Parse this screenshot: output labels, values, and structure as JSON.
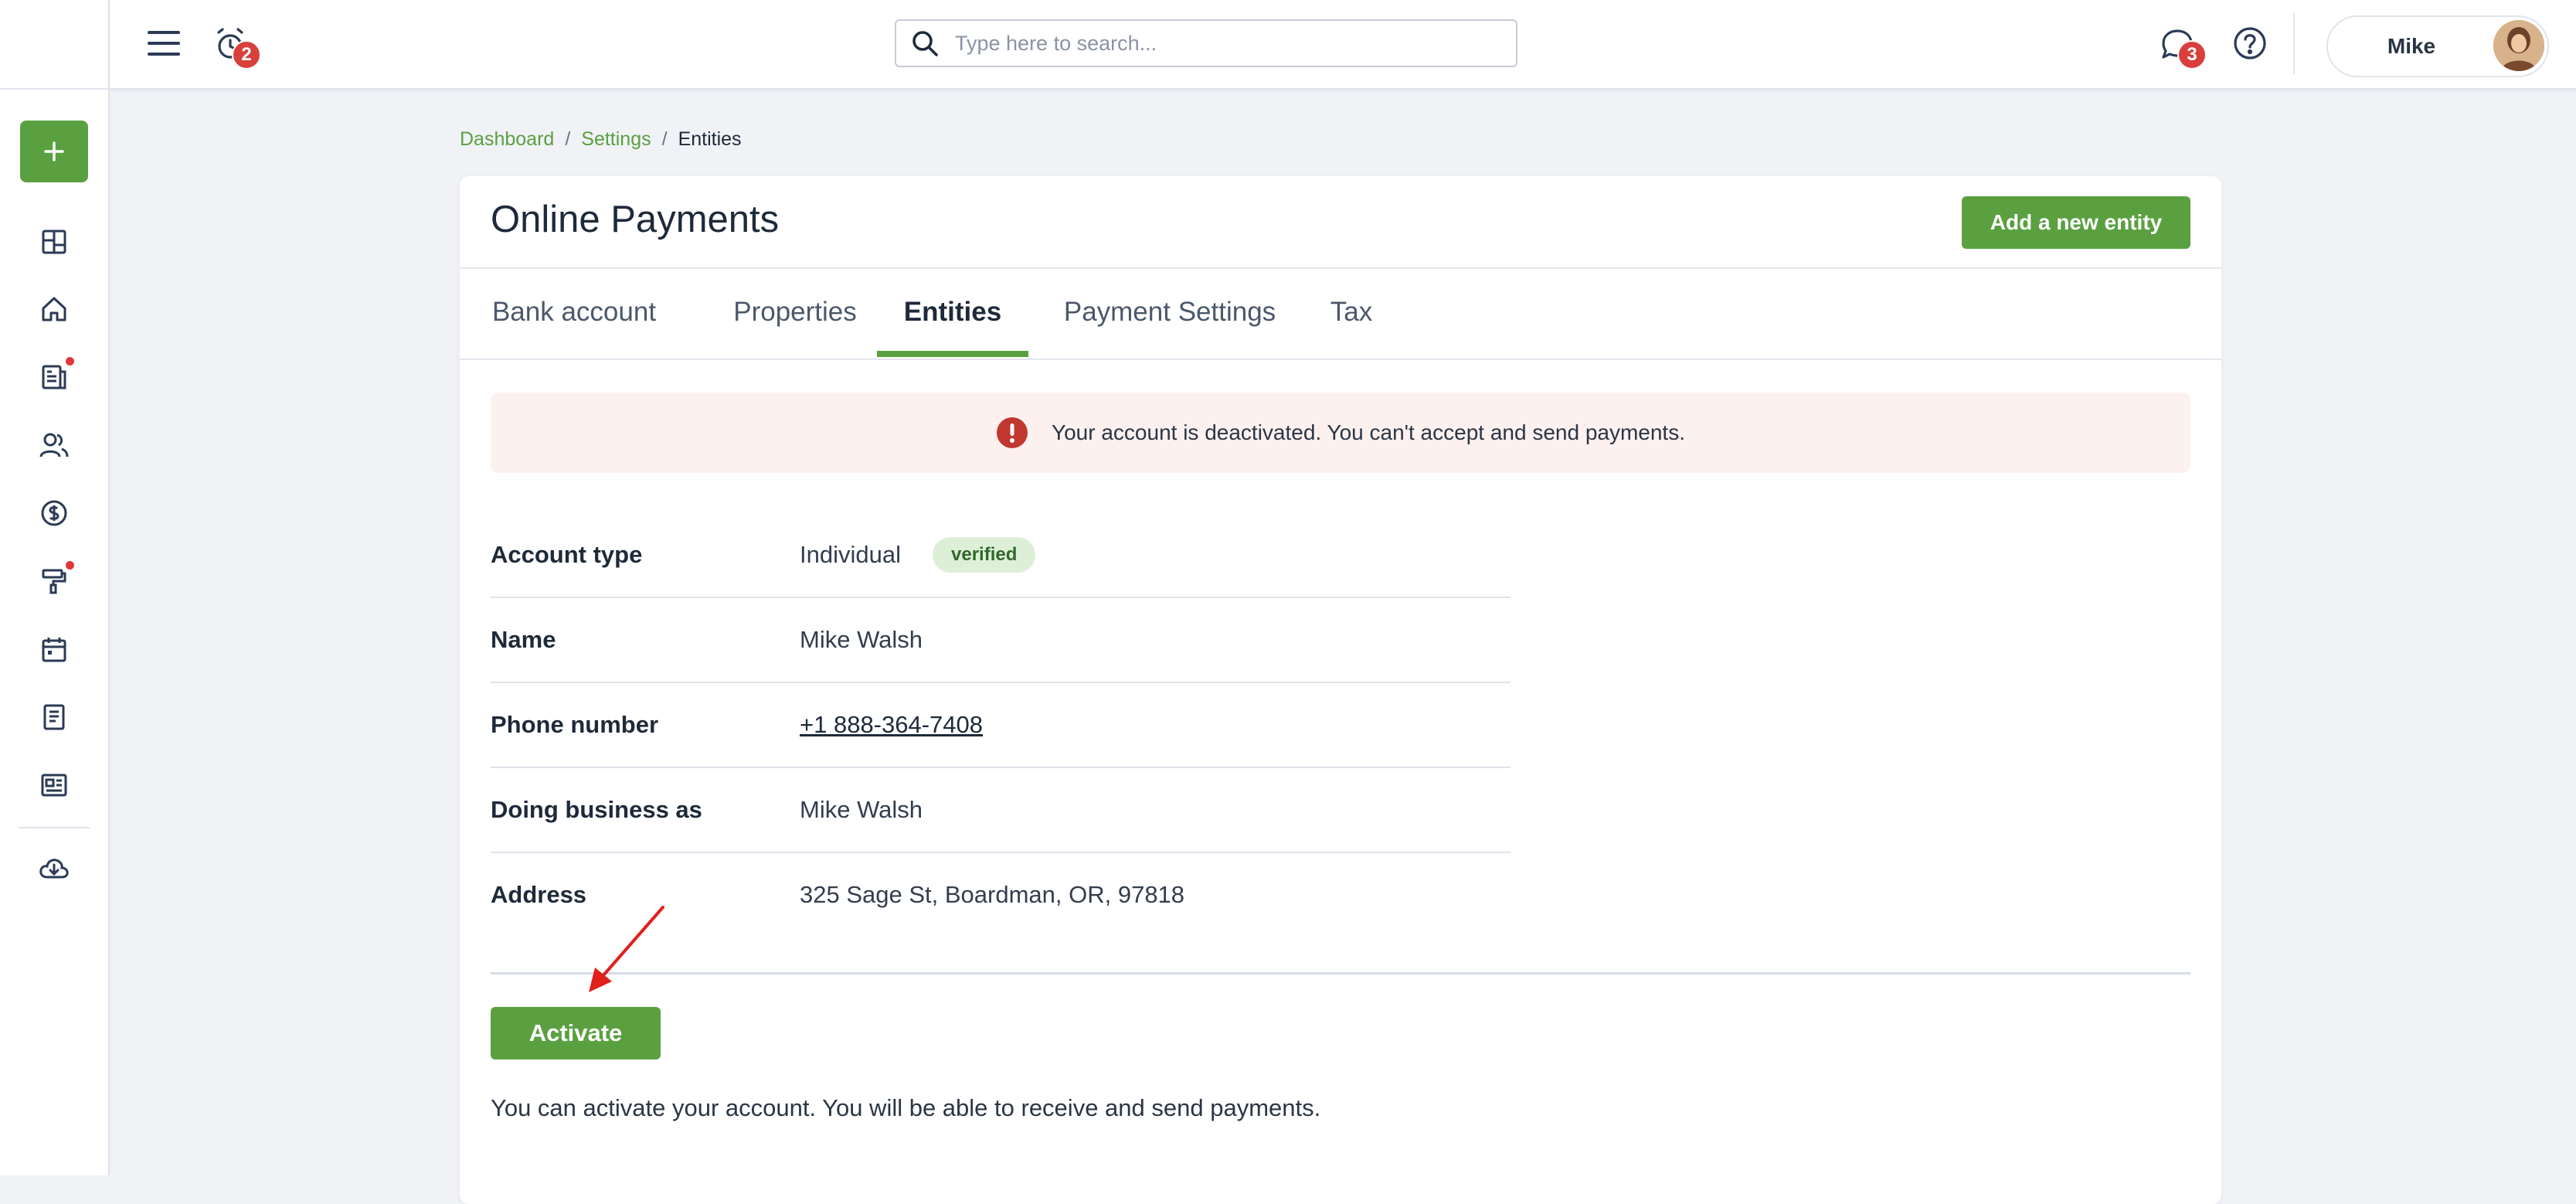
{
  "topbar": {
    "notifications_count": "2",
    "messages_count": "3",
    "search_placeholder": "Type here to search...",
    "user_name": "Mike"
  },
  "breadcrumb": {
    "items": [
      "Dashboard",
      "Settings"
    ],
    "current": "Entities",
    "separator": "/"
  },
  "page": {
    "title": "Online Payments",
    "add_button": "Add a new entity"
  },
  "tabs": [
    "Bank account",
    "Properties",
    "Entities",
    "Payment Settings",
    "Tax"
  ],
  "active_tab": "Entities",
  "alert": {
    "text": "Your account is deactivated. You can't accept and send payments.",
    "icon": "exclamation-icon"
  },
  "details": [
    {
      "label": "Account type",
      "value": "Individual",
      "badge": "verified"
    },
    {
      "label": "Name",
      "value": "Mike Walsh"
    },
    {
      "label": "Phone number",
      "value": "+1 888-364-7408"
    },
    {
      "label": "Doing business as",
      "value": "Mike Walsh"
    },
    {
      "label": "Address",
      "value": "325 Sage St, Boardman, OR, 97818"
    }
  ],
  "activate": {
    "button": "Activate",
    "note": "You can activate your account. You will be able to receive and send payments."
  },
  "sidebar": {
    "create_icon": "plus-icon",
    "items": [
      {
        "icon": "dashboard-grid-icon"
      },
      {
        "icon": "home-icon"
      },
      {
        "icon": "leases-document-icon",
        "dot": true
      },
      {
        "icon": "people-icon"
      },
      {
        "icon": "dollar-icon"
      },
      {
        "icon": "maintenance-roller-icon",
        "dot": true
      },
      {
        "icon": "calendar-icon"
      },
      {
        "icon": "notes-icon"
      },
      {
        "icon": "reports-icon"
      },
      {
        "icon": "download-cloud-icon"
      }
    ]
  },
  "colors": {
    "accent": "#5aa040",
    "badge": "#d9403c",
    "alert_bg": "#fdf1ef",
    "alert_icon": "#c0372f",
    "annotation_arrow": "#e0201c"
  }
}
